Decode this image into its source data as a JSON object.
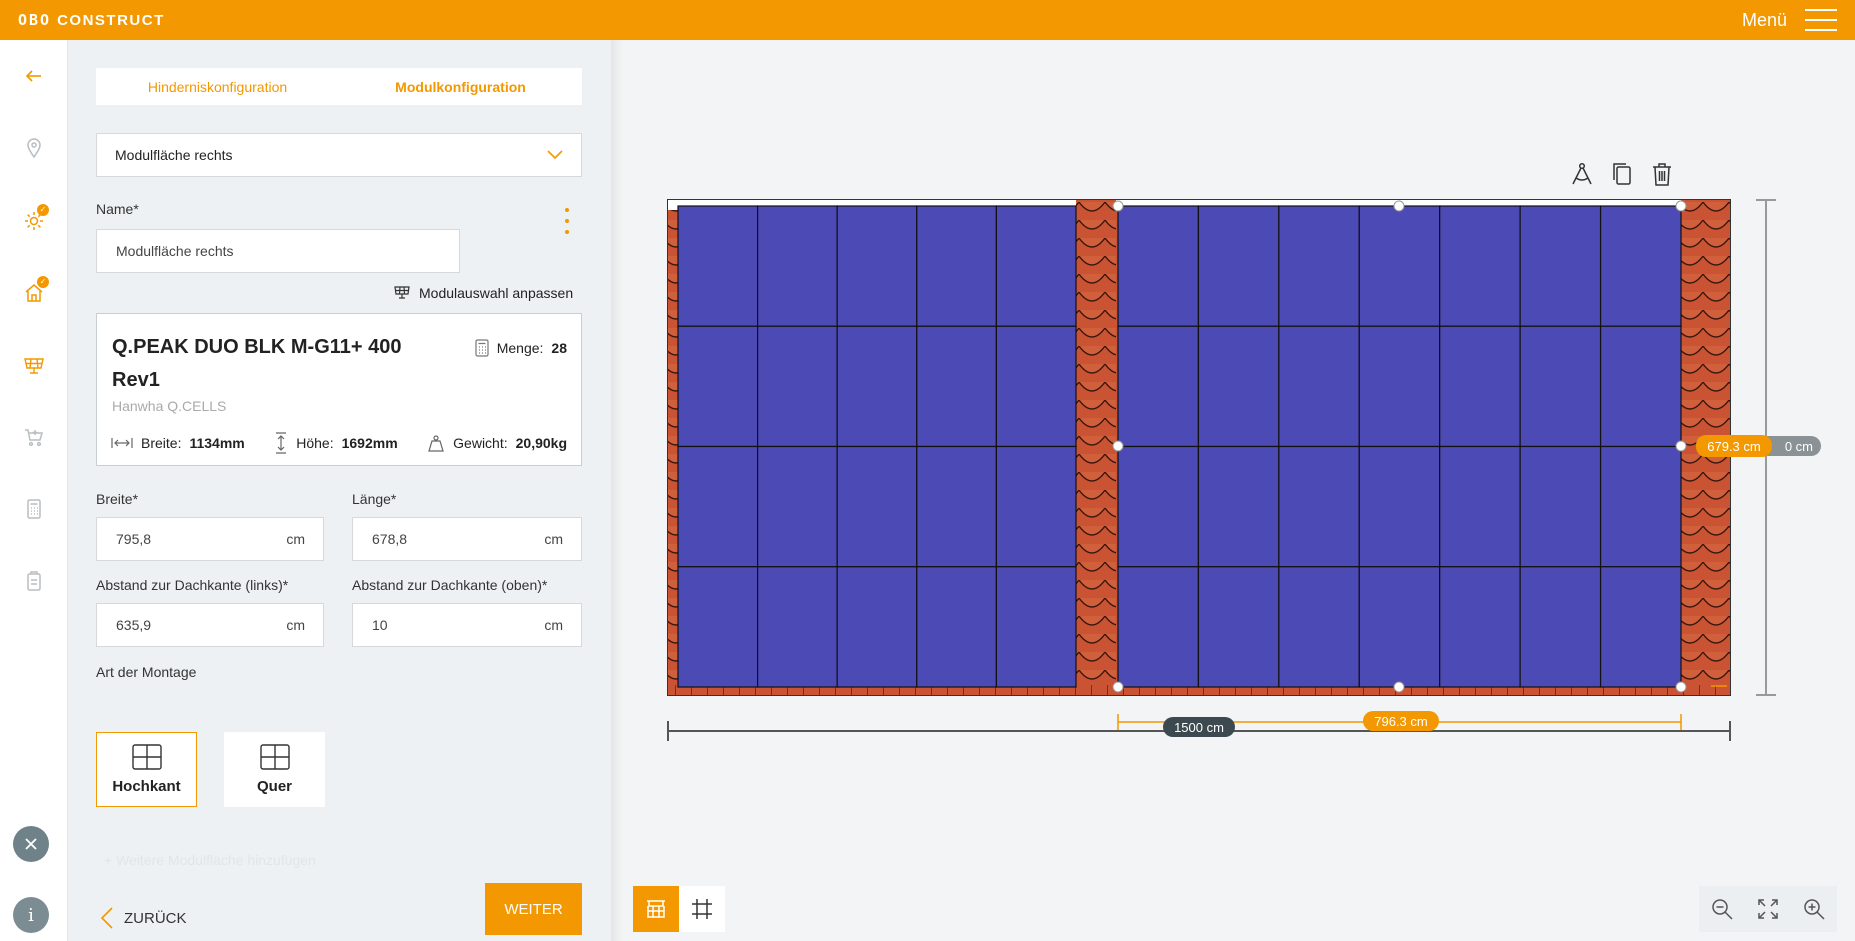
{
  "app": {
    "brand_prefix": "OBO",
    "brand_name": "CONSTRUCT",
    "menu_label": "Menü"
  },
  "colors": {
    "accent": "#f39800",
    "module": "#4c4ab5",
    "tile": "#c95332",
    "dark_pill": "#3c4a4f",
    "gray_pill": "#8a9296"
  },
  "rail": {
    "items": [
      {
        "icon": "back-arrow-icon"
      },
      {
        "icon": "location-pin-icon"
      },
      {
        "icon": "settings-gear-icon",
        "done": true
      },
      {
        "icon": "house-icon",
        "done": true
      },
      {
        "icon": "solar-panel-icon",
        "active": true
      },
      {
        "icon": "cart-icon"
      },
      {
        "icon": "calculator-icon"
      },
      {
        "icon": "clipboard-icon"
      }
    ],
    "close_icon": "close-icon",
    "info_icon": "info-icon",
    "info_label": "i"
  },
  "tabs": [
    {
      "label": "Hinderniskonfiguration",
      "active": false
    },
    {
      "label": "Modulkonfiguration",
      "active": true
    }
  ],
  "area_select": {
    "value": "Modulfläche rechts"
  },
  "name_field": {
    "label": "Name*",
    "value": "Modulfläche rechts"
  },
  "adjust_link": "Modulauswahl anpassen",
  "module": {
    "name": "Q.PEAK DUO BLK M-G11+ 400 Rev1",
    "maker": "Hanwha Q.CELLS",
    "qty_label": "Menge:",
    "qty": "28",
    "width_label": "Breite:",
    "width": "1134mm",
    "height_label": "Höhe:",
    "height": "1692mm",
    "weight_label": "Gewicht:",
    "weight": "20,90kg"
  },
  "fields": {
    "breite": {
      "label": "Breite*",
      "value": "795,8",
      "unit": "cm"
    },
    "laenge": {
      "label": "Länge*",
      "value": "678,8",
      "unit": "cm"
    },
    "abstand_links": {
      "label": "Abstand zur Dachkante (links)*",
      "value": "635,9",
      "unit": "cm"
    },
    "abstand_oben": {
      "label": "Abstand zur Dachkante (oben)*",
      "value": "10",
      "unit": "cm"
    }
  },
  "mounting": {
    "label": "Art der Montage",
    "options": [
      {
        "label": "Hochkant",
        "active": true
      },
      {
        "label": "Quer",
        "active": false
      }
    ]
  },
  "add_area": "+ Weitere Modulfläche hinzufügen",
  "nav": {
    "back": "ZURÜCK",
    "next": "WEITER"
  },
  "canvas": {
    "dims": {
      "roof_width": "1500 cm",
      "area_width": "796.3 cm",
      "area_height": "679.3 cm",
      "offset_right": "0 cm"
    },
    "panels": {
      "left_rows": 4,
      "left_cols": 5,
      "right_rows": 4,
      "right_cols": 7
    },
    "tools": [
      "ruler-compass-icon",
      "copy-icon",
      "trash-icon"
    ],
    "view_modes": [
      {
        "icon": "roof-view-icon",
        "active": true
      },
      {
        "icon": "frame-view-icon",
        "active": false
      }
    ],
    "zoom": [
      "zoom-out-icon",
      "fit-screen-icon",
      "zoom-in-icon"
    ]
  }
}
